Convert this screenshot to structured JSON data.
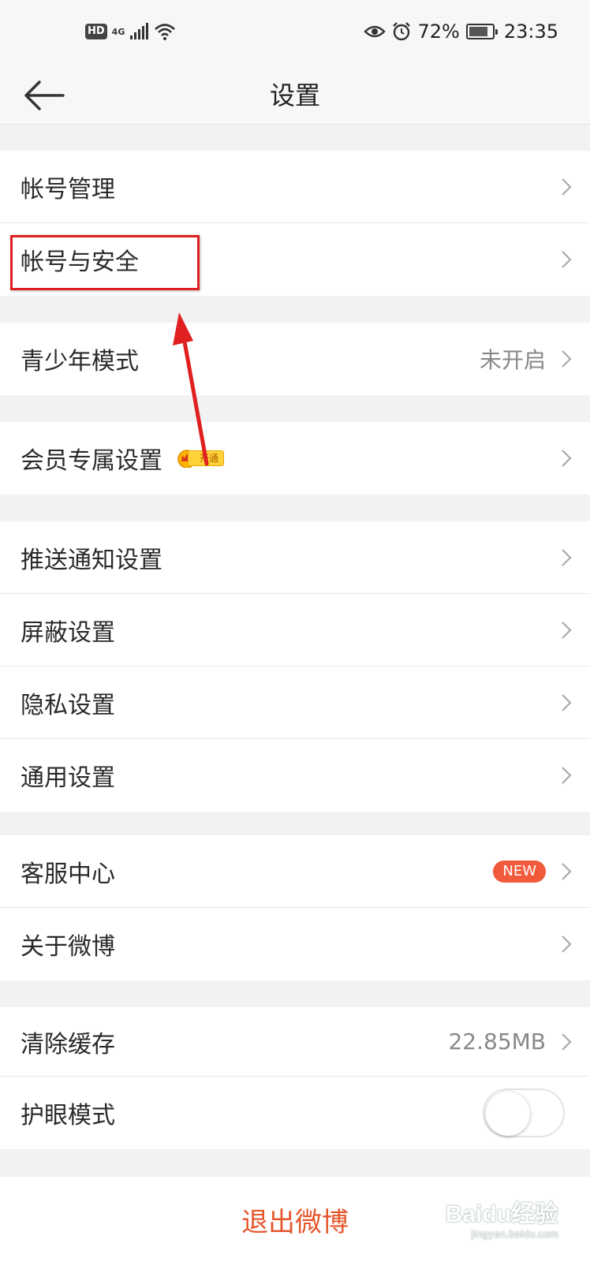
{
  "status_bar": {
    "hd": "HD",
    "network": "4G",
    "battery_pct": "72%",
    "time": "23:35"
  },
  "header": {
    "title": "设置"
  },
  "groups": [
    {
      "items": [
        {
          "label": "帐号管理"
        },
        {
          "label": "帐号与安全"
        }
      ]
    },
    {
      "items": [
        {
          "label": "青少年模式",
          "value": "未开启"
        }
      ]
    },
    {
      "items": [
        {
          "label": "会员专属设置",
          "badge": "开通"
        }
      ]
    },
    {
      "items": [
        {
          "label": "推送通知设置"
        },
        {
          "label": "屏蔽设置"
        },
        {
          "label": "隐私设置"
        },
        {
          "label": "通用设置"
        }
      ]
    },
    {
      "items": [
        {
          "label": "客服中心",
          "badge": "NEW"
        },
        {
          "label": "关于微博"
        }
      ]
    },
    {
      "items": [
        {
          "label": "清除缓存",
          "value": "22.85MB"
        },
        {
          "label": "护眼模式",
          "toggle": false
        }
      ]
    }
  ],
  "logout_label": "退出微博",
  "watermark": {
    "logo": "Baidu经验",
    "url": "jingyan.baidu.com"
  },
  "colors": {
    "accent": "#e5572d",
    "badge_new": "#f25a3c",
    "annotation": "#e02020"
  }
}
